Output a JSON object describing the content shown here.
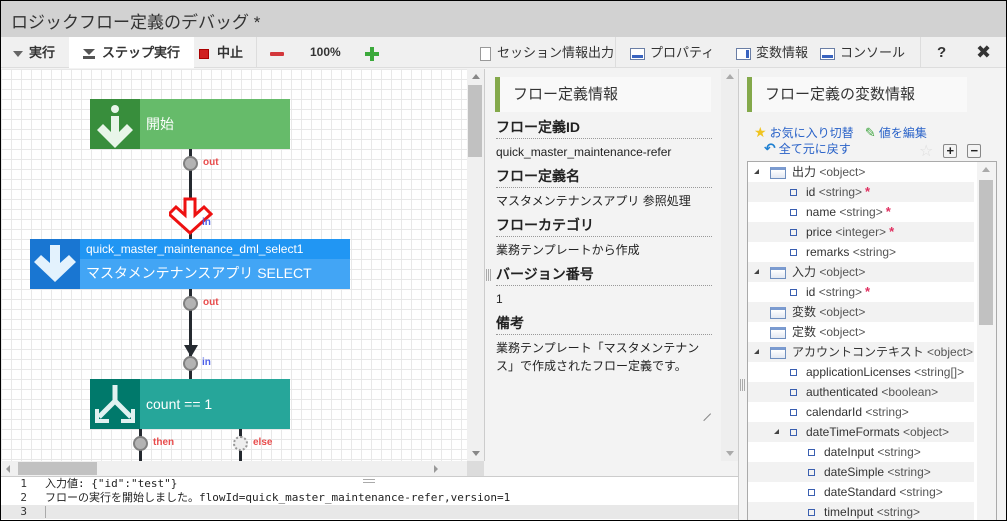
{
  "window": {
    "title": "ロジックフロー定義のデバッグ  *"
  },
  "toolbar": {
    "run": "実行",
    "step_run": "ステップ実行",
    "stop": "中止",
    "zoom_level": "100%",
    "session_export": "セッション情報出力",
    "properties": "プロパティ",
    "variables": "変数情報",
    "console": "コンソール",
    "help": "?",
    "close": "✖"
  },
  "canvas": {
    "nodes": [
      {
        "type": "start",
        "label": "開始",
        "color": "#66bb6a",
        "icon_color": "#388e3c"
      },
      {
        "type": "dml",
        "id": "quick_master_maintenance_dml_select1",
        "label": "マスタメンテナンスアプリ SELECT",
        "color": "#42a5f5",
        "header_color": "#2196f3",
        "icon_color": "#1976d2"
      },
      {
        "type": "condition",
        "label": "count == 1",
        "color": "#26a69a",
        "icon_color": "#00796b"
      }
    ],
    "ports": {
      "out": "out",
      "in": "in",
      "then": "then",
      "else": "else"
    },
    "breakpoint_color": "#ff0000"
  },
  "flow_info": {
    "header": "フロー定義情報",
    "fields": [
      {
        "label": "フロー定義ID",
        "value": "quick_master_maintenance-refer"
      },
      {
        "label": "フロー定義名",
        "value": "マスタメンテナンスアプリ 参照処理"
      },
      {
        "label": "フローカテゴリ",
        "value": "業務テンプレートから作成"
      },
      {
        "label": "バージョン番号",
        "value": "1"
      },
      {
        "label": "備考",
        "value": "業務テンプレート「マスタメンテナンス」で作成されたフロー定義です。"
      }
    ]
  },
  "vars": {
    "header": "フロー定義の変数情報",
    "favorite_toggle": "お気に入り切替",
    "edit_value": "値を編集",
    "reset_all": "全て元に戻す",
    "tree": [
      {
        "level": 0,
        "expanded": true,
        "kind": "folder",
        "name": "出力",
        "type": "<object>"
      },
      {
        "level": 1,
        "kind": "leaf",
        "name": "id",
        "type": "<string>",
        "required": true
      },
      {
        "level": 1,
        "kind": "leaf",
        "name": "name",
        "type": "<string>",
        "required": true
      },
      {
        "level": 1,
        "kind": "leaf",
        "name": "price",
        "type": "<integer>",
        "required": true
      },
      {
        "level": 1,
        "kind": "leaf",
        "name": "remarks",
        "type": "<string>",
        "required": false
      },
      {
        "level": 0,
        "expanded": true,
        "kind": "folder",
        "name": "入力",
        "type": "<object>"
      },
      {
        "level": 1,
        "kind": "leaf",
        "name": "id",
        "type": "<string>",
        "required": true
      },
      {
        "level": 0,
        "kind": "folder",
        "name": "変数",
        "type": "<object>"
      },
      {
        "level": 0,
        "kind": "folder",
        "name": "定数",
        "type": "<object>"
      },
      {
        "level": 0,
        "expanded": true,
        "kind": "folder",
        "name": "アカウントコンテキスト",
        "type": "<object>"
      },
      {
        "level": 1,
        "kind": "leaf",
        "name": "applicationLicenses",
        "type": "<string[]>"
      },
      {
        "level": 1,
        "kind": "leaf",
        "name": "authenticated",
        "type": "<boolean>"
      },
      {
        "level": 1,
        "kind": "leaf",
        "name": "calendarId",
        "type": "<string>"
      },
      {
        "level": 1,
        "expanded": true,
        "kind": "leaf",
        "name": "dateTimeFormats",
        "type": "<object>"
      },
      {
        "level": 2,
        "kind": "leaf",
        "name": "dateInput",
        "type": "<string>"
      },
      {
        "level": 2,
        "kind": "leaf",
        "name": "dateSimple",
        "type": "<string>"
      },
      {
        "level": 2,
        "kind": "leaf",
        "name": "dateStandard",
        "type": "<string>"
      },
      {
        "level": 2,
        "kind": "leaf",
        "name": "timeInput",
        "type": "<string>"
      }
    ]
  },
  "console": {
    "lines": [
      {
        "num": "1",
        "text": "入力値: {\"id\":\"test\"}"
      },
      {
        "num": "2",
        "text": "フローの実行を開始しました。flowId=quick_master_maintenance-refer,version=1"
      },
      {
        "num": "3",
        "text": ""
      }
    ]
  }
}
